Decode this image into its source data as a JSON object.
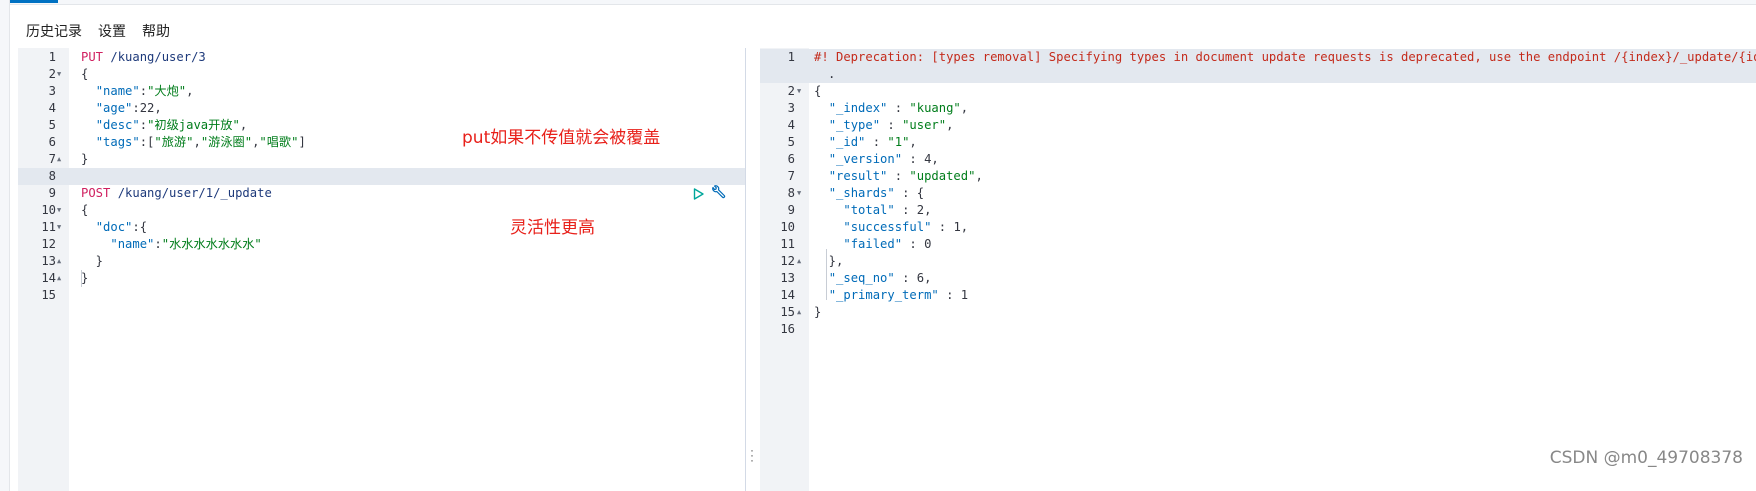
{
  "menu": {
    "history": "历史记录",
    "settings": "设置",
    "help": "帮助"
  },
  "request_lines": [
    {
      "n": "1",
      "fold": "",
      "parts": [
        [
          "c-method",
          "PUT"
        ],
        [
          "c-url",
          " /kuang/user/3"
        ]
      ]
    },
    {
      "n": "2",
      "fold": "▼",
      "parts": [
        [
          "c-punc",
          "{"
        ]
      ]
    },
    {
      "n": "3",
      "fold": "",
      "parts": [
        [
          "c-punc",
          "  "
        ],
        [
          "c-key",
          "\"name\""
        ],
        [
          "c-punc",
          ":"
        ],
        [
          "c-str",
          "\"大炮\""
        ],
        [
          "c-punc",
          ","
        ]
      ]
    },
    {
      "n": "4",
      "fold": "",
      "parts": [
        [
          "c-punc",
          "  "
        ],
        [
          "c-key",
          "\"age\""
        ],
        [
          "c-punc",
          ":"
        ],
        [
          "c-num",
          "22"
        ],
        [
          "c-punc",
          ","
        ]
      ]
    },
    {
      "n": "5",
      "fold": "",
      "parts": [
        [
          "c-punc",
          "  "
        ],
        [
          "c-key",
          "\"desc\""
        ],
        [
          "c-punc",
          ":"
        ],
        [
          "c-str",
          "\"初级java开放\""
        ],
        [
          "c-punc",
          ","
        ]
      ]
    },
    {
      "n": "6",
      "fold": "",
      "parts": [
        [
          "c-punc",
          "  "
        ],
        [
          "c-key",
          "\"tags\""
        ],
        [
          "c-punc",
          ":["
        ],
        [
          "c-str",
          "\"旅游\""
        ],
        [
          "c-punc",
          ","
        ],
        [
          "c-str",
          "\"游泳圈\""
        ],
        [
          "c-punc",
          ","
        ],
        [
          "c-str",
          "\"唱歌\""
        ],
        [
          "c-punc",
          "]"
        ]
      ]
    },
    {
      "n": "7",
      "fold": "▲",
      "parts": [
        [
          "c-punc",
          "}"
        ]
      ]
    },
    {
      "n": "8",
      "fold": "",
      "parts": [],
      "active": true
    },
    {
      "n": "9",
      "fold": "",
      "parts": [
        [
          "c-method",
          "POST"
        ],
        [
          "c-url",
          " /kuang/user/1/_update"
        ]
      ]
    },
    {
      "n": "10",
      "fold": "▼",
      "parts": [
        [
          "c-punc",
          "{"
        ]
      ]
    },
    {
      "n": "11",
      "fold": "▼",
      "parts": [
        [
          "c-punc",
          "  "
        ],
        [
          "c-key",
          "\"doc\""
        ],
        [
          "c-punc",
          ":{"
        ]
      ]
    },
    {
      "n": "12",
      "fold": "",
      "parts": [
        [
          "c-punc",
          "    "
        ],
        [
          "c-key",
          "\"name\""
        ],
        [
          "c-punc",
          ":"
        ],
        [
          "c-str",
          "\"水水水水水水水\""
        ]
      ]
    },
    {
      "n": "13",
      "fold": "▲",
      "parts": [
        [
          "c-punc",
          "  }"
        ]
      ]
    },
    {
      "n": "14",
      "fold": "▲",
      "parts": [
        [
          "c-punc",
          "}"
        ]
      ]
    },
    {
      "n": "15",
      "fold": "",
      "parts": []
    }
  ],
  "response_lines": [
    {
      "n": "1",
      "fold": "",
      "parts": [
        [
          "c-warn",
          "#! Deprecation: [types removal] Specifying types in document update requests is deprecated, use the endpoint /{index}/_update/{id} instead."
        ]
      ],
      "active": true,
      "tall": true
    },
    {
      "n": "2",
      "fold": "▼",
      "parts": [
        [
          "c-punc",
          "{"
        ]
      ]
    },
    {
      "n": "3",
      "fold": "",
      "parts": [
        [
          "c-punc",
          "  "
        ],
        [
          "c-key",
          "\"_index\""
        ],
        [
          "c-punc",
          " : "
        ],
        [
          "c-str",
          "\"kuang\""
        ],
        [
          "c-punc",
          ","
        ]
      ]
    },
    {
      "n": "4",
      "fold": "",
      "parts": [
        [
          "c-punc",
          "  "
        ],
        [
          "c-key",
          "\"_type\""
        ],
        [
          "c-punc",
          " : "
        ],
        [
          "c-str",
          "\"user\""
        ],
        [
          "c-punc",
          ","
        ]
      ]
    },
    {
      "n": "5",
      "fold": "",
      "parts": [
        [
          "c-punc",
          "  "
        ],
        [
          "c-key",
          "\"_id\""
        ],
        [
          "c-punc",
          " : "
        ],
        [
          "c-str",
          "\"1\""
        ],
        [
          "c-punc",
          ","
        ]
      ]
    },
    {
      "n": "6",
      "fold": "",
      "parts": [
        [
          "c-punc",
          "  "
        ],
        [
          "c-key",
          "\"_version\""
        ],
        [
          "c-punc",
          " : "
        ],
        [
          "c-num",
          "4"
        ],
        [
          "c-punc",
          ","
        ]
      ]
    },
    {
      "n": "7",
      "fold": "",
      "parts": [
        [
          "c-punc",
          "  "
        ],
        [
          "c-key",
          "\"result\""
        ],
        [
          "c-punc",
          " : "
        ],
        [
          "c-str",
          "\"updated\""
        ],
        [
          "c-punc",
          ","
        ]
      ]
    },
    {
      "n": "8",
      "fold": "▼",
      "parts": [
        [
          "c-punc",
          "  "
        ],
        [
          "c-key",
          "\"_shards\""
        ],
        [
          "c-punc",
          " : {"
        ]
      ]
    },
    {
      "n": "9",
      "fold": "",
      "parts": [
        [
          "c-punc",
          "    "
        ],
        [
          "c-key",
          "\"total\""
        ],
        [
          "c-punc",
          " : "
        ],
        [
          "c-num",
          "2"
        ],
        [
          "c-punc",
          ","
        ]
      ]
    },
    {
      "n": "10",
      "fold": "",
      "parts": [
        [
          "c-punc",
          "    "
        ],
        [
          "c-key",
          "\"successful\""
        ],
        [
          "c-punc",
          " : "
        ],
        [
          "c-num",
          "1"
        ],
        [
          "c-punc",
          ","
        ]
      ]
    },
    {
      "n": "11",
      "fold": "",
      "parts": [
        [
          "c-punc",
          "    "
        ],
        [
          "c-key",
          "\"failed\""
        ],
        [
          "c-punc",
          " : "
        ],
        [
          "c-num",
          "0"
        ]
      ]
    },
    {
      "n": "12",
      "fold": "▲",
      "parts": [
        [
          "c-punc",
          "  },"
        ]
      ]
    },
    {
      "n": "13",
      "fold": "",
      "parts": [
        [
          "c-punc",
          "  "
        ],
        [
          "c-key",
          "\"_seq_no\""
        ],
        [
          "c-punc",
          " : "
        ],
        [
          "c-num",
          "6"
        ],
        [
          "c-punc",
          ","
        ]
      ]
    },
    {
      "n": "14",
      "fold": "",
      "parts": [
        [
          "c-punc",
          "  "
        ],
        [
          "c-key",
          "\"_primary_term\""
        ],
        [
          "c-punc",
          " : "
        ],
        [
          "c-num",
          "1"
        ]
      ]
    },
    {
      "n": "15",
      "fold": "▲",
      "parts": [
        [
          "c-punc",
          "}"
        ]
      ]
    },
    {
      "n": "16",
      "fold": "",
      "parts": []
    }
  ],
  "annotations": {
    "put_note": "put如果不传值就会被覆盖",
    "post_note": "灵活性更高"
  },
  "watermark": "CSDN @m0_49708378",
  "colors": {
    "accent": "#0071c2",
    "annotation": "#e8201a"
  }
}
